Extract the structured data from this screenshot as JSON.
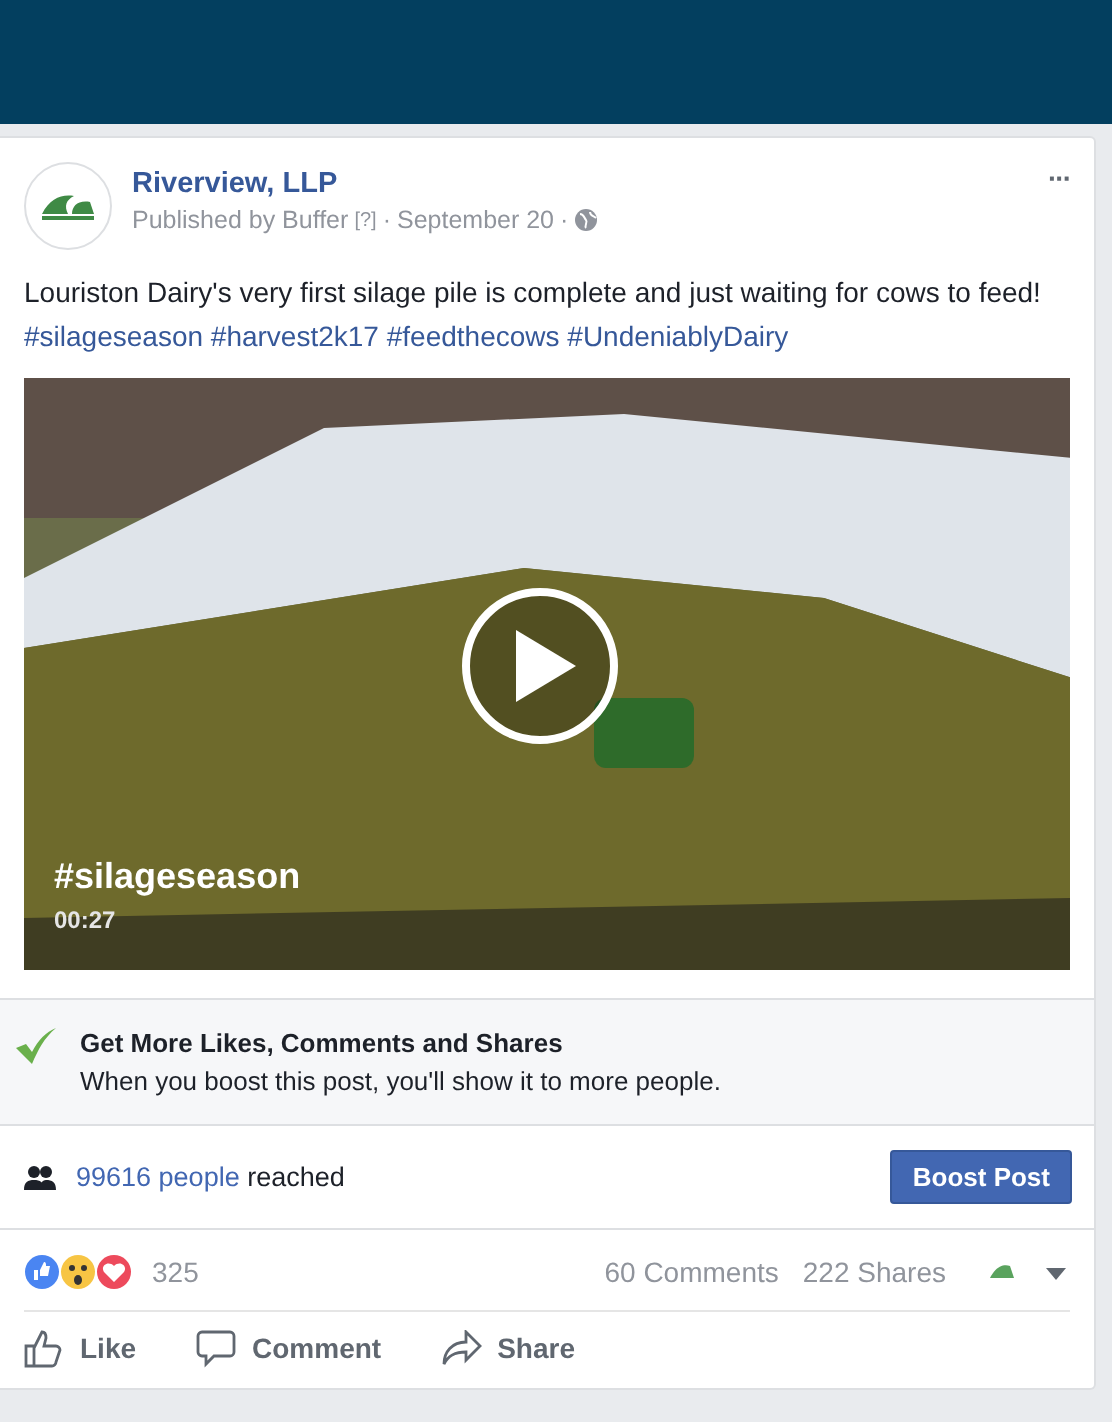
{
  "post": {
    "page_name": "Riverview, LLP",
    "published_by": "Published by Buffer",
    "help_mark": "[?]",
    "date": "September 20",
    "separator": "·",
    "text": "Louriston Dairy's very first silage pile is complete and just waiting for cows to feed!",
    "hashtags": [
      "#silageseason",
      "#harvest2k17",
      "#feedthecows",
      "#UndeniablyDairy"
    ],
    "more": "···"
  },
  "video": {
    "caption": "#silageseason",
    "duration": "00:27"
  },
  "boost_tip": {
    "title": "Get More Likes, Comments and Shares",
    "body": "When you boost this post, you'll show it to more people."
  },
  "reach": {
    "count": "99616 people",
    "suffix": "reached",
    "button": "Boost Post"
  },
  "stats": {
    "reactions": "325",
    "comments": "60 Comments",
    "shares": "222 Shares"
  },
  "actions": [
    {
      "kind": "like",
      "label": "Like"
    },
    {
      "kind": "comment",
      "label": "Comment"
    },
    {
      "kind": "share",
      "label": "Share"
    }
  ]
}
